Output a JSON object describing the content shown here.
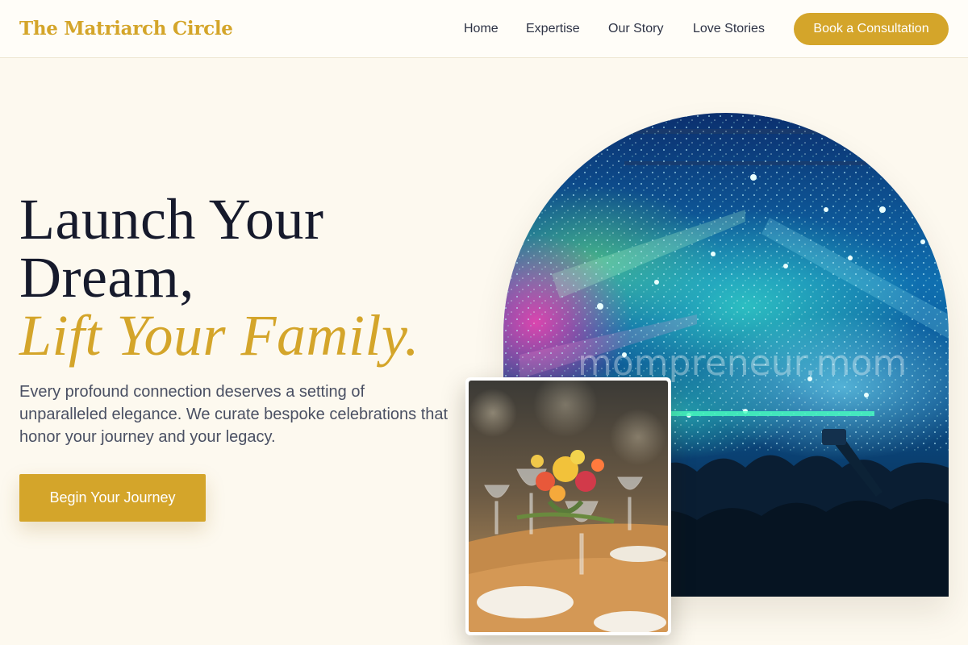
{
  "header": {
    "brand": "The Matriarch Circle",
    "nav": [
      "Home",
      "Expertise",
      "Our Story",
      "Love Stories"
    ],
    "cta": "Book a Consultation"
  },
  "hero": {
    "line1": "Launch Your",
    "line2": "Dream,",
    "line3": "Lift Your Family.",
    "subtext": "Every profound connection deserves a setting of unparalleled elegance. We curate bespoke celebrations that honor your journey and your legacy.",
    "button": "Begin Your Journey"
  },
  "images": {
    "watermark": "mompreneur.mom"
  },
  "colors": {
    "accent": "#d4a52a",
    "background": "#fdf9ef",
    "heading": "#161a2c"
  }
}
